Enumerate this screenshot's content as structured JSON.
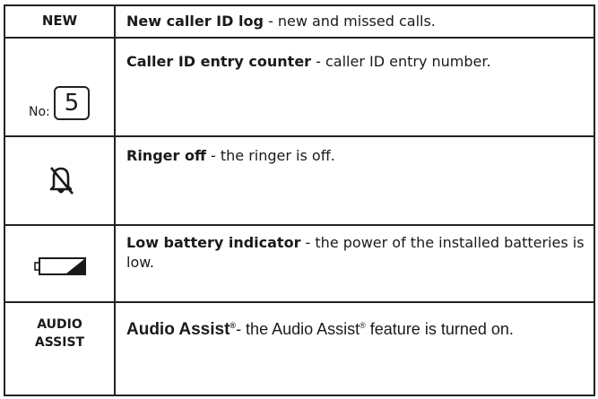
{
  "rows": [
    {
      "icon_label": "NEW",
      "title": "New caller ID log",
      "desc": " - new and missed calls."
    },
    {
      "counter_prefix": "No:",
      "counter_value": "5",
      "title": "Caller ID entry counter",
      "desc": " - caller ID entry number."
    },
    {
      "icon": "bell-off-icon",
      "title": "Ringer off",
      "desc": " - the ringer is off."
    },
    {
      "icon": "low-battery-icon",
      "title": "Low battery indicator",
      "desc": " - the power of the installed batteries is low."
    },
    {
      "icon_label_line1": "AUDIO",
      "icon_label_line2": "ASSIST",
      "title": "Audio Assist",
      "trademark": "®",
      "desc_part1": "- the Audio Assist",
      "desc_part2": " feature is turned on."
    }
  ]
}
